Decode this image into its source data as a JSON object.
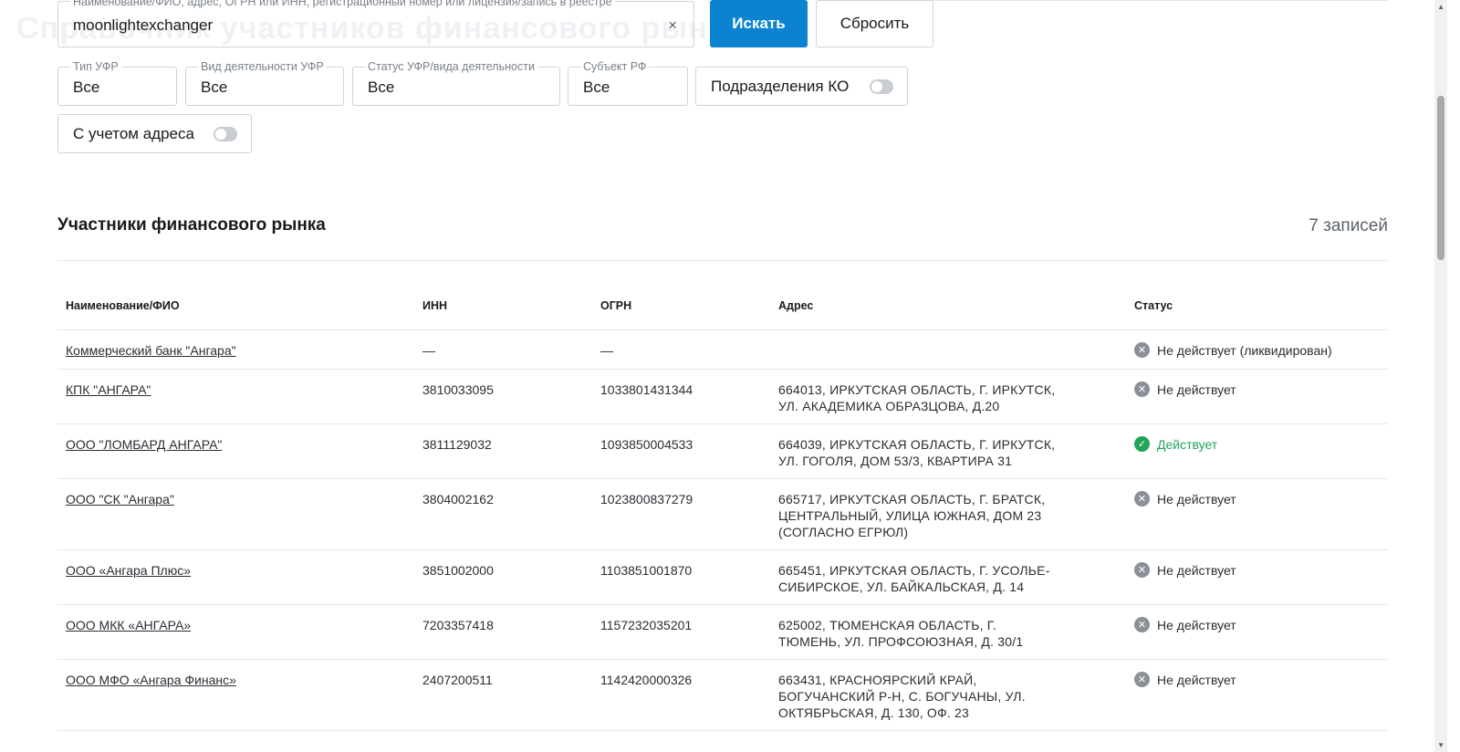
{
  "header": {
    "ghost_title": "Справочник участников финансового рынка"
  },
  "search": {
    "legend": "Наименование/ФИО, адрес, ОГРН или ИНН, регистрационный номер или лицензия/запись в реестре",
    "value": "moonlightexchanger",
    "clear_icon": "×",
    "search_label": "Искать",
    "reset_label": "Сбросить"
  },
  "filters": {
    "type": {
      "legend": "Тип УФР",
      "value": "Все"
    },
    "activity": {
      "legend": "Вид деятельности УФР",
      "value": "Все"
    },
    "status": {
      "legend": "Статус УФР/вида деятельности",
      "value": "Все"
    },
    "region": {
      "legend": "Субъект РФ",
      "value": "Все"
    },
    "branches_label": "Подразделения КО",
    "address_label": "С учетом адреса"
  },
  "section": {
    "title": "Участники финансового рынка",
    "count": "7 записей"
  },
  "table": {
    "headers": [
      "Наименование/ФИО",
      "ИНН",
      "ОГРН",
      "Адрес",
      "Статус"
    ],
    "rows": [
      {
        "name": "Коммерческий банк \"Ангара\"",
        "inn": "—",
        "ogrn": "—",
        "address": "",
        "status": "Не действует (ликвидирован)",
        "active": false
      },
      {
        "name": "КПК \"АНГАРА\"",
        "inn": "3810033095",
        "ogrn": "1033801431344",
        "address": "664013, Иркутская область, г. Иркутск, ул. Академика Образцова, д.20",
        "status": "Не действует",
        "active": false
      },
      {
        "name": "ООО \"ЛОМБАРД АНГАРА\"",
        "inn": "3811129032",
        "ogrn": "1093850004533",
        "address": "664039, Иркутская область, г. Иркутск, ул. Гоголя, дом 53/3, квартира 31",
        "status": "Действует",
        "active": true
      },
      {
        "name": "ООО \"СК \"Ангара\"",
        "inn": "3804002162",
        "ogrn": "1023800837279",
        "address": "665717, Иркутская область, г. Братск, Центральный, улица Южная, дом 23 (согласно ЕГРЮЛ)",
        "status": "Не действует",
        "active": false
      },
      {
        "name": "ООО «Ангара Плюс»",
        "inn": "3851002000",
        "ogrn": "1103851001870",
        "address": "665451, Иркутская область, г. Усолье-Сибирское, ул. Байкальская, д. 14",
        "status": "Не действует",
        "active": false
      },
      {
        "name": "ООО МКК «АНГАРА»",
        "inn": "7203357418",
        "ogrn": "1157232035201",
        "address": "625002, Тюменская область, г. Тюмень, ул. Профсоюзная, д. 30/1",
        "status": "Не действует",
        "active": false
      },
      {
        "name": "ООО МФО «Ангара Финанс»",
        "inn": "2407200511",
        "ogrn": "1142420000326",
        "address": "663431, Красноярский край, Богучанский р-н, с. Богучаны, ул. Октябрьская, д. 130, оф. 23",
        "status": "Не действует",
        "active": false
      }
    ]
  },
  "colors": {
    "primary": "#0b83d0",
    "active_status": "#22a45d",
    "inactive_status": "#8a8f98"
  }
}
